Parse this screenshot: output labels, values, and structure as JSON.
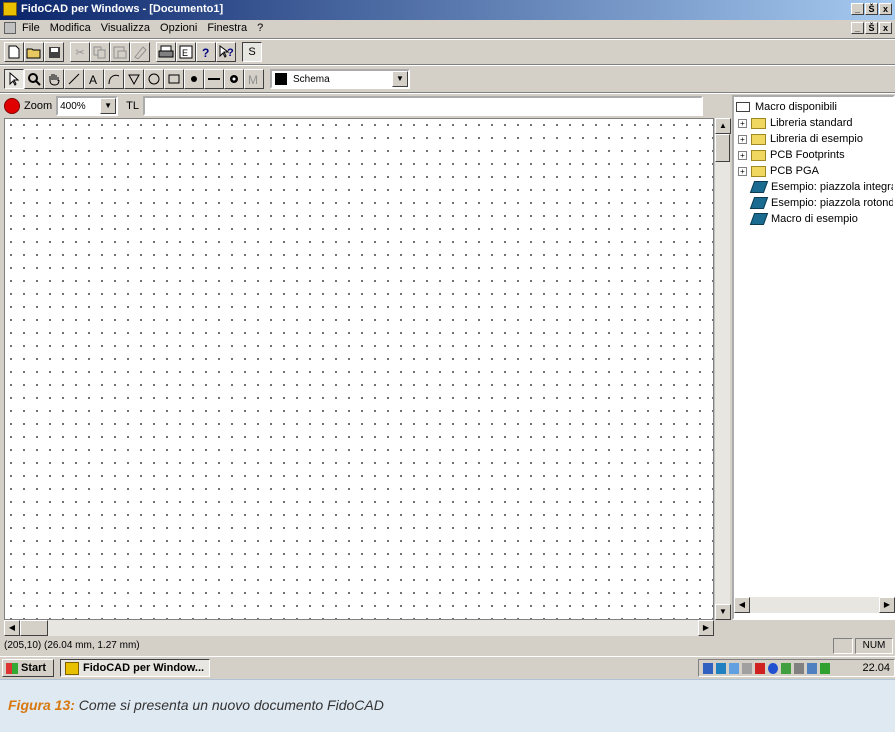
{
  "window": {
    "title": "FidoCAD per Windows - [Documento1]",
    "controls": [
      "_",
      "Š",
      "x"
    ],
    "doc_controls": [
      "_",
      "Š",
      "x"
    ]
  },
  "menu": [
    "File",
    "Modifica",
    "Visualizza",
    "Opzioni",
    "Finestra",
    "?"
  ],
  "toolbar1": {
    "buttons": [
      "new-icon",
      "open-icon",
      "save-icon",
      "cut-icon",
      "copy-icon",
      "paste-icon",
      "eraser-icon",
      "print-icon",
      "export-icon",
      "help-icon",
      "context-help-icon"
    ],
    "s_label": "S"
  },
  "toolbar2": {
    "tools": [
      "select-icon",
      "zoom-icon",
      "pan-icon",
      "line-icon",
      "text-icon",
      "bezier-icon",
      "polygon-icon",
      "ellipse-icon",
      "rectangle-icon",
      "connection-icon",
      "pcb-line-icon",
      "pcb-pad-icon",
      "macro-icon"
    ],
    "layer": "Schema",
    "layer_color": "#000000"
  },
  "zoom": {
    "label": "Zoom",
    "value": "400%",
    "tl_label": "TL",
    "tl_value": ""
  },
  "macros": {
    "root": "Macro disponibili",
    "folders": [
      "Libreria standard",
      "Libreria di esempio",
      "PCB Footprints",
      "PCB PGA"
    ],
    "items": [
      "Esempio: piazzola integrato gr",
      "Esempio: piazzola rotonda gra",
      "Macro di esempio"
    ]
  },
  "status": {
    "coords": "(205,10) (26.04 mm, 1.27 mm)",
    "num": "NUM"
  },
  "taskbar": {
    "start": "Start",
    "task": "FidoCAD per Window...",
    "clock": "22.04"
  },
  "caption": {
    "label": "Figura 13:",
    "text": "Come si presenta un nuovo documento FidoCAD"
  }
}
